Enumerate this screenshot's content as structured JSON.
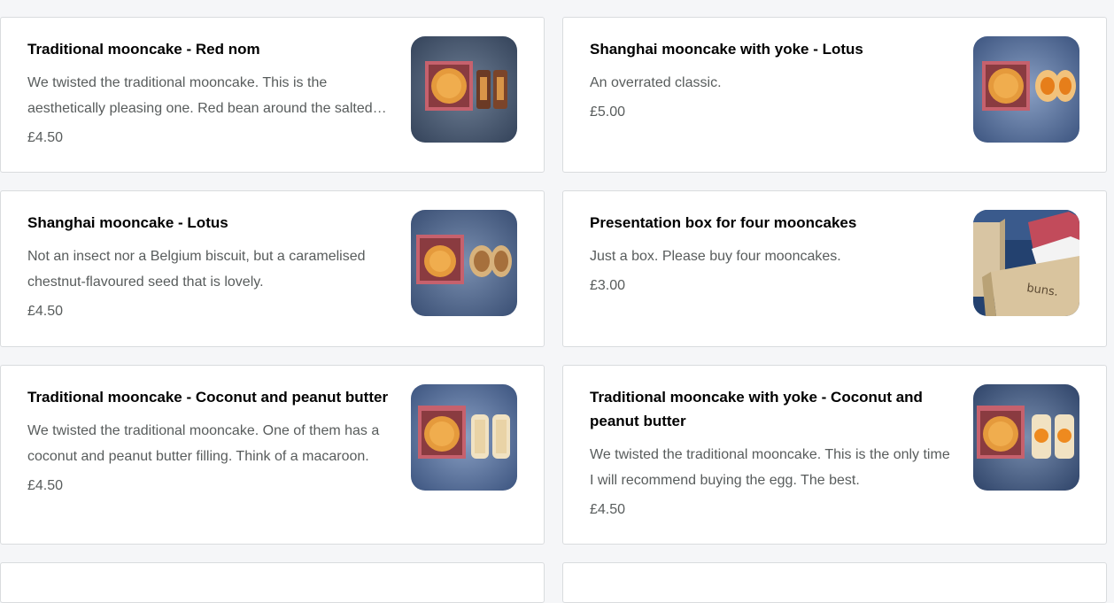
{
  "menu": {
    "items": [
      {
        "title": "Traditional mooncake - Red nom",
        "description": "We twisted the traditional mooncake. This is the aesthetically pleasing one. Red bean around the salted egg yolk.",
        "price": "£4.50",
        "image_icon": "mooncake-box-photo-icon"
      },
      {
        "title": "Shanghai mooncake with yoke - Lotus",
        "description": "An overrated classic.",
        "price": "£5.00",
        "image_icon": "mooncake-yolk-photo-icon"
      },
      {
        "title": "Shanghai mooncake - Lotus",
        "description": "Not an insect nor a Belgium biscuit, but a caramelised chestnut-flavoured seed that is lovely.",
        "price": "£4.50",
        "image_icon": "mooncake-lotus-photo-icon"
      },
      {
        "title": "Presentation box for four mooncakes",
        "description": "Just a box. Please buy four mooncakes.",
        "price": "£3.00",
        "image_icon": "presentation-box-photo-icon"
      },
      {
        "title": "Traditional mooncake - Coconut and peanut butter",
        "description": "We twisted the traditional mooncake. One of them has a coconut and peanut butter filling. Think of a macaroon.",
        "price": "£4.50",
        "image_icon": "mooncake-coconut-photo-icon"
      },
      {
        "title": "Traditional mooncake with yoke - Coconut and peanut butter",
        "description": "We twisted the traditional mooncake. This is the only time I will recommend buying the egg. The best.",
        "price": "£4.50",
        "image_icon": "mooncake-coconut-yolk-photo-icon"
      }
    ],
    "box_brand_label": "buns."
  },
  "colors": {
    "page_background": "#f5f6f8",
    "card_border": "#d9dcde",
    "title_text": "#000000",
    "body_text": "#585c5c"
  }
}
